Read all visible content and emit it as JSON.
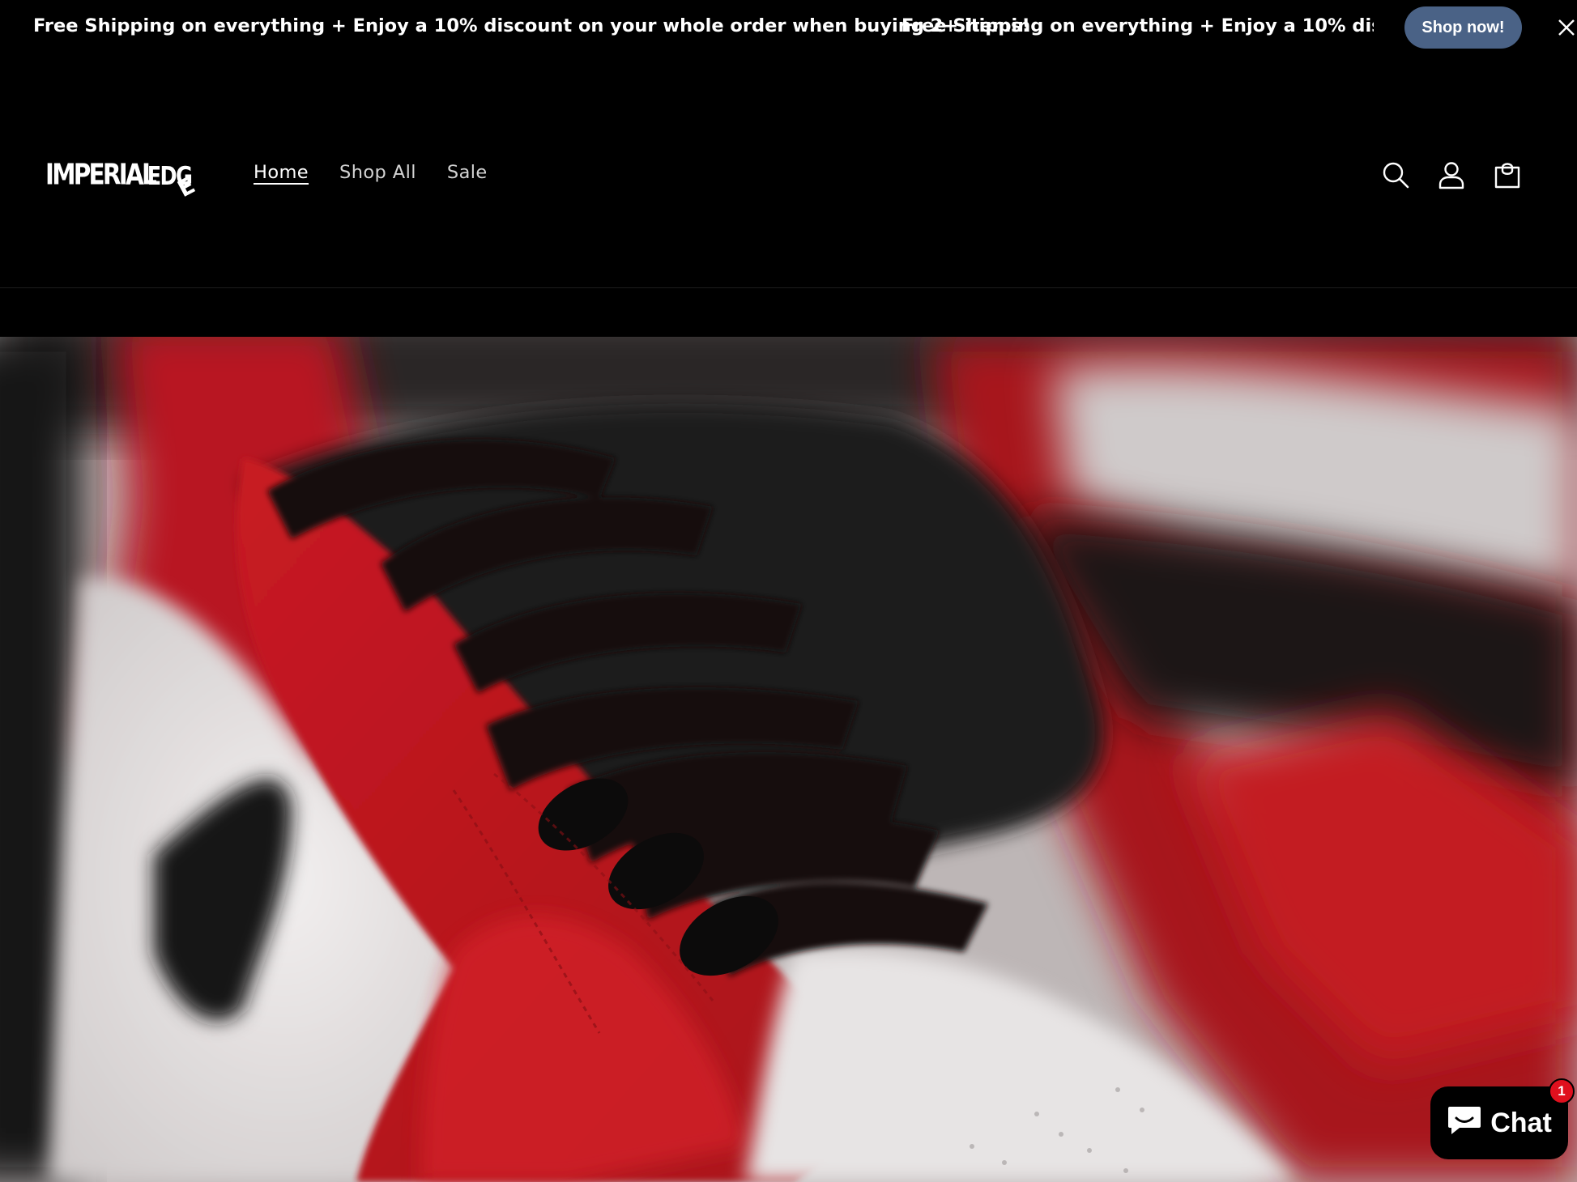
{
  "announcement": {
    "message": "Free Shipping on everything + Enjoy a 10% discount on your whole order when buying 2+ items!",
    "message_partial": "Free Shipping on everything + Enjoy a 10% discount on",
    "cta_label": "Shop now!",
    "close_icon": "close-icon",
    "background": "#000000",
    "cta_color": "#4a6286"
  },
  "header": {
    "logo_text": "IMPERIAL EDGE",
    "nav": [
      {
        "label": "Home",
        "active": true
      },
      {
        "label": "Shop All",
        "active": false
      },
      {
        "label": "Sale",
        "active": false
      }
    ],
    "icons": [
      "search-icon",
      "account-icon",
      "cart-icon"
    ]
  },
  "hero": {
    "image": "close-up of red, white and black high-top sneakers with black laces"
  },
  "chat": {
    "label": "Chat",
    "badge_count": "1",
    "icon": "chat-bubble-icon"
  }
}
